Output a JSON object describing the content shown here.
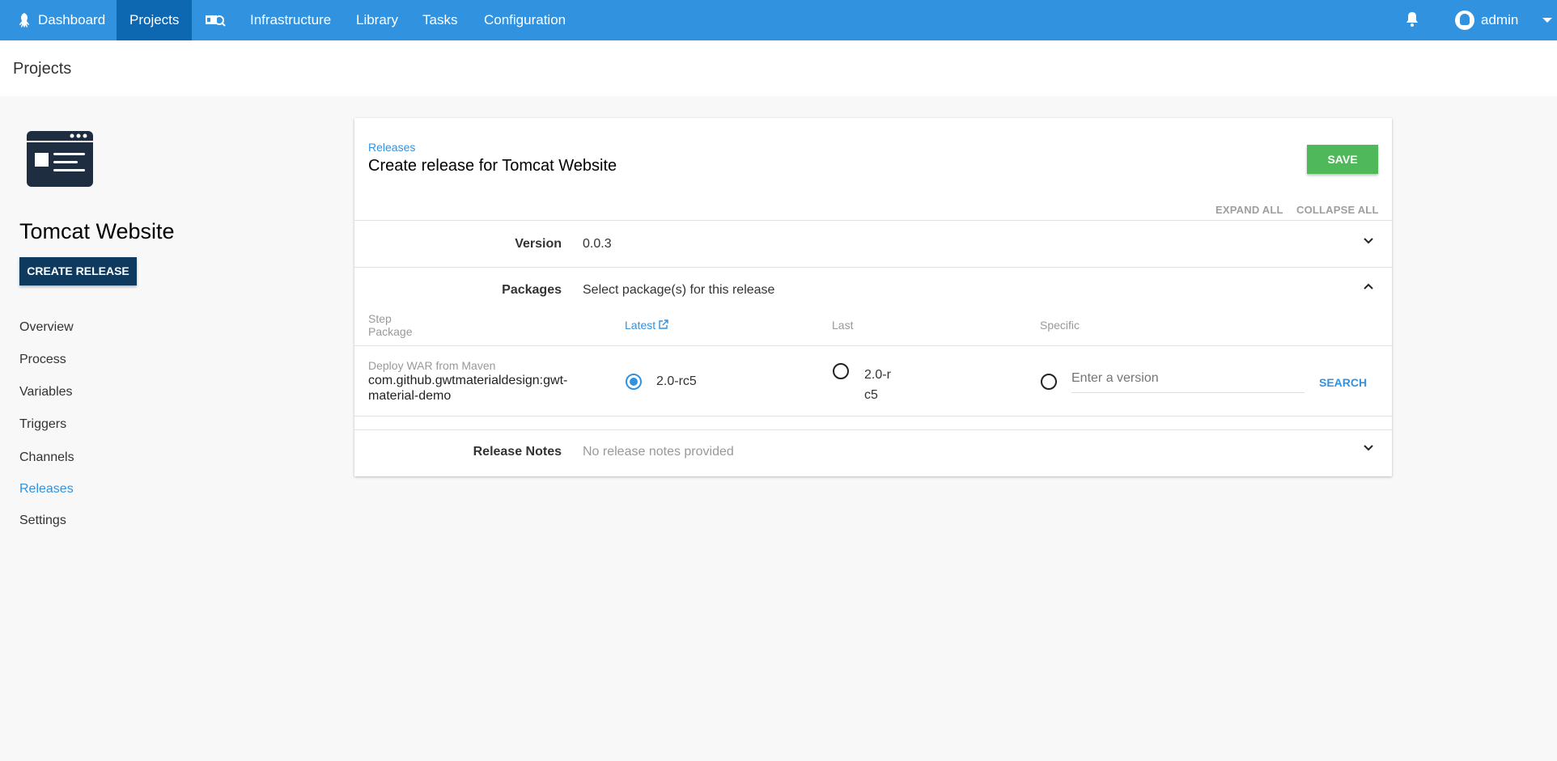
{
  "nav": {
    "items": [
      {
        "label": "Dashboard"
      },
      {
        "label": "Projects"
      },
      {
        "label": ""
      },
      {
        "label": "Infrastructure"
      },
      {
        "label": "Library"
      },
      {
        "label": "Tasks"
      },
      {
        "label": "Configuration"
      }
    ],
    "user": "admin"
  },
  "header": {
    "title": "Projects"
  },
  "project": {
    "name": "Tomcat Website",
    "create_release": "CREATE RELEASE"
  },
  "sidebar": {
    "items": [
      {
        "label": "Overview"
      },
      {
        "label": "Process"
      },
      {
        "label": "Variables"
      },
      {
        "label": "Triggers"
      },
      {
        "label": "Channels"
      },
      {
        "label": "Releases"
      },
      {
        "label": "Settings"
      }
    ]
  },
  "card": {
    "breadcrumb": "Releases",
    "title": "Create release for Tomcat Website",
    "save": "SAVE",
    "expand_all": "EXPAND ALL",
    "collapse_all": "COLLAPSE ALL",
    "version": {
      "label": "Version",
      "value": "0.0.3"
    },
    "packages": {
      "label": "Packages",
      "value": "Select package(s) for this release",
      "columns": {
        "step": "Step",
        "package": "Package",
        "latest": "Latest",
        "last": "Last",
        "specific": "Specific"
      },
      "rows": [
        {
          "step": "Deploy WAR from Maven",
          "package": "com.github.gwtmaterialdesign:gwt-material-demo",
          "latest": "2.0-rc5",
          "last": "2.0-rc5",
          "specific_placeholder": "Enter a version",
          "search": "SEARCH",
          "selected": "latest"
        }
      ]
    },
    "notes": {
      "label": "Release Notes",
      "value": "No release notes provided"
    }
  },
  "colors": {
    "nav": "#3192df",
    "nav_active": "#0d67b1",
    "save": "#4fb85a",
    "primary_dark": "#0f3a5f"
  }
}
